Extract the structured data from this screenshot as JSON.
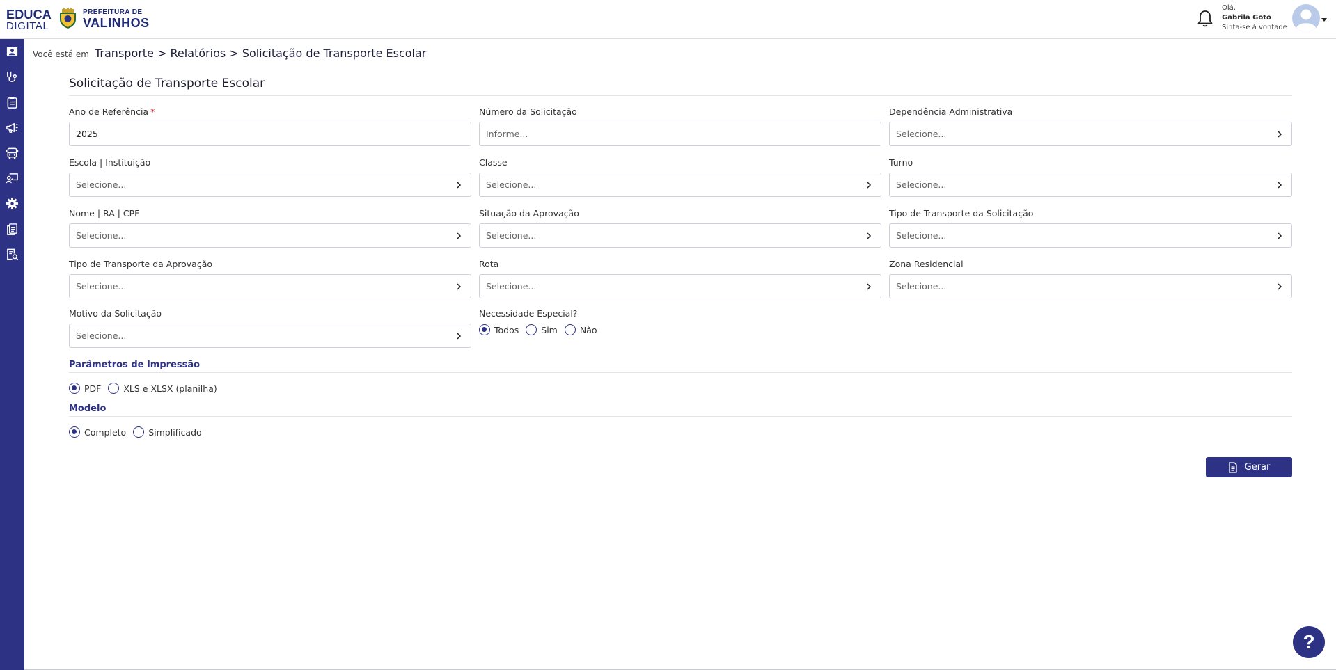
{
  "header": {
    "logo_line1": "EDUCA",
    "logo_line2": "DIGITAL",
    "pref_line1": "PREFEITURA DE",
    "pref_line2": "VALINHOS",
    "greeting": "Olá,",
    "user_name": "Gabrila Goto",
    "user_tagline": "Sinta-se à vontade"
  },
  "sidebar": {
    "items": [
      {
        "icon": "graduation-icon"
      },
      {
        "icon": "stethoscope-icon"
      },
      {
        "icon": "clipboard-icon"
      },
      {
        "icon": "megaphone-icon"
      },
      {
        "icon": "bus-icon"
      },
      {
        "icon": "teacher-board-icon"
      },
      {
        "icon": "gear-icon"
      },
      {
        "icon": "documents-icon"
      },
      {
        "icon": "report-search-icon"
      }
    ]
  },
  "breadcrumb": {
    "prefix": "Você está em",
    "path": "Transporte > Relatórios > Solicitação de Transporte Escolar"
  },
  "page": {
    "title": "Solicitação de Transporte Escolar"
  },
  "form": {
    "ano_label": "Ano de Referência",
    "ano_required": "*",
    "ano_value": "2025",
    "numero_label": "Número da Solicitação",
    "numero_placeholder": "Informe...",
    "dependencia_label": "Dependência Administrativa",
    "escola_label": "Escola | Instituição",
    "classe_label": "Classe",
    "turno_label": "Turno",
    "nome_label": "Nome | RA | CPF",
    "situacao_label": "Situação da Aprovação",
    "tipo_solic_label": "Tipo de Transporte da Solicitação",
    "tipo_aprov_label": "Tipo de Transporte da Aprovação",
    "rota_label": "Rota",
    "zona_label": "Zona Residencial",
    "motivo_label": "Motivo da Solicitação",
    "select_placeholder": "Selecione...",
    "necessidade_label": "Necessidade Especial?",
    "necessidade_options": [
      "Todos",
      "Sim",
      "Não"
    ],
    "necessidade_selected": "Todos"
  },
  "impressao": {
    "title": "Parâmetros de Impressão",
    "options": [
      "PDF",
      "XLS e XLSX (planilha)"
    ],
    "selected": "PDF"
  },
  "modelo": {
    "title": "Modelo",
    "options": [
      "Completo",
      "Simplificado"
    ],
    "selected": "Completo"
  },
  "actions": {
    "gerar_label": "Gerar"
  },
  "help": {
    "label": "?"
  },
  "colors": {
    "primary": "#2e3284",
    "required": "#d9262c"
  }
}
